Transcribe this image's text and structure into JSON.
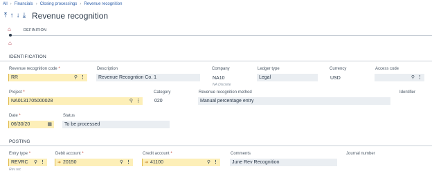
{
  "breadcrumb": [
    "All",
    "Financials",
    "Closing processings",
    "Revenue recognition"
  ],
  "title": "Revenue recognition",
  "tabs": [
    {
      "label": "DEFINITION"
    }
  ],
  "sections": {
    "identification": "IDENTIFICATION",
    "posting": "POSTING"
  },
  "fields": {
    "revenue_code": {
      "label": "Revenue recognition code",
      "value": "RR"
    },
    "description": {
      "label": "Description",
      "value": "Revenue Recogntion Co. 1"
    },
    "company": {
      "label": "Company",
      "value": "NA10",
      "sub": "NA Discrete"
    },
    "ledger_type": {
      "label": "Ledger type",
      "value": "Legal"
    },
    "currency": {
      "label": "Currency",
      "value": "USD"
    },
    "access_code": {
      "label": "Access code",
      "value": ""
    },
    "project": {
      "label": "Project",
      "value": "NA0131705000028"
    },
    "category": {
      "label": "Category",
      "value": "020"
    },
    "method": {
      "label": "Revenue recognition method",
      "value": "Manual percentage entry"
    },
    "identifier": {
      "label": "Identifier",
      "value": ""
    },
    "date": {
      "label": "Date",
      "value": "06/30/20"
    },
    "status": {
      "label": "Status",
      "value": "To be processed"
    },
    "entry_type": {
      "label": "Entry type",
      "value": "REVRC",
      "sub": "Rev rec"
    },
    "debit_account": {
      "label": "Debit account",
      "value": "20150"
    },
    "credit_account": {
      "label": "Credit account",
      "value": "41100"
    },
    "comments": {
      "label": "Comments",
      "value": "June Rev Recognition"
    },
    "journal_number": {
      "label": "Journal number",
      "value": ""
    }
  },
  "required_mark": "*",
  "icons": {
    "search": "search-icon",
    "more": "more-icon",
    "calendar": "calendar-icon",
    "home": "home-icon"
  }
}
